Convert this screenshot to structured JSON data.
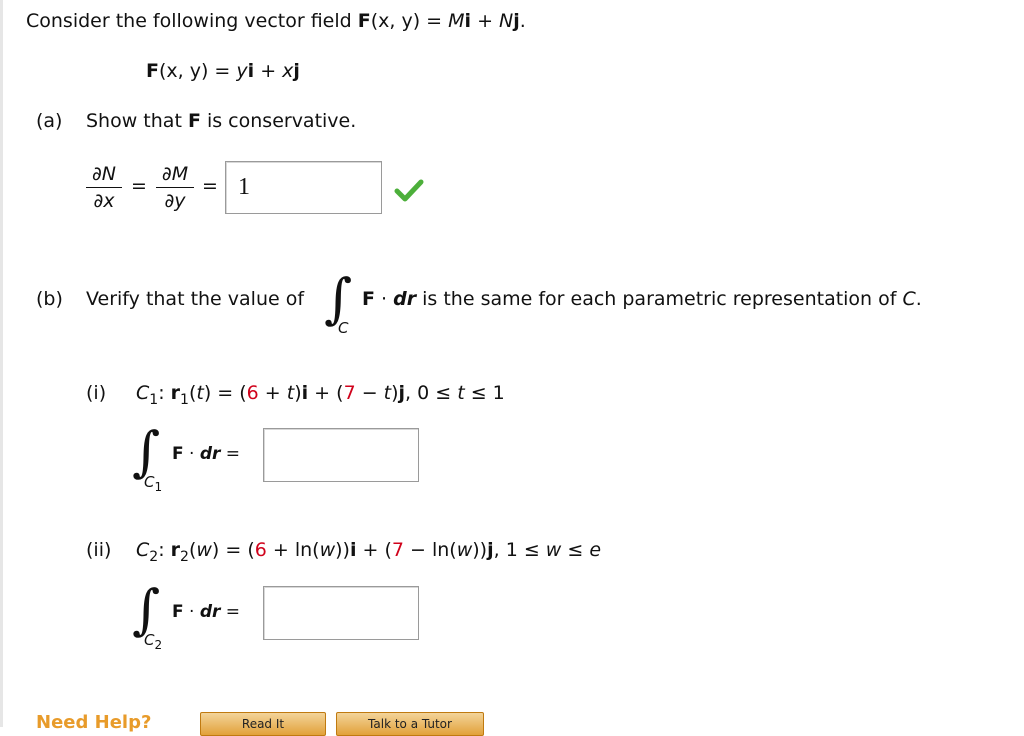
{
  "intro": {
    "text": "Consider the following vector field ",
    "F": "F",
    "args": "(x, y) = ",
    "M": "M",
    "i": "i",
    "plus": " + ",
    "N": "N",
    "j": "j",
    "end": "."
  },
  "field": {
    "F": "F",
    "args": "(x, y) = ",
    "y": "y",
    "i": "i",
    "plus": " + ",
    "x": "x",
    "j": "j"
  },
  "part_a": {
    "label": "(a)",
    "text_before": "Show that ",
    "F": "F",
    "text_after": " is conservative.",
    "num1": "∂N",
    "den1": "∂x",
    "eq1": "=",
    "num2": "∂M",
    "den2": "∂y",
    "eq2": "=",
    "answer": "1"
  },
  "part_b": {
    "label": "(b)",
    "text_before": "Verify that the value of",
    "integral_sub": "C",
    "F": "F",
    "dot": " · ",
    "dr": "dr",
    "text_after": " is the same for each parametric representation of ",
    "C": "C",
    "end": "."
  },
  "part_i": {
    "label": "(i)",
    "C": "C",
    "C_sub": "1",
    "colon": ": ",
    "r": "r",
    "r_sub": "1",
    "t_open": "(",
    "t": "t",
    "t_close": ") = (",
    "six": "6",
    "plus_t": " + ",
    "t2": "t",
    "close_i": ")",
    "i": "i",
    "plus": " + (",
    "seven": "7",
    "minus_t": " − ",
    "t3": "t",
    "close_j": ")",
    "j": "j",
    "range": ", 0 ≤ ",
    "t4": "t",
    "range_end": " ≤ 1",
    "integral_C": "C",
    "integral_sub": "1",
    "F": "F",
    "dot": " · ",
    "dr": "dr",
    "eq": " =",
    "answer": ""
  },
  "part_ii": {
    "label": "(ii)",
    "C": "C",
    "C_sub": "2",
    "colon": ": ",
    "r": "r",
    "r_sub": "2",
    "w_open": "(",
    "w": "w",
    "w_close": ") = (",
    "six": "6",
    "plus_ln": " + ln(",
    "w2": "w",
    "close_i": "))",
    "i": "i",
    "plus": " + (",
    "seven": "7",
    "minus_ln": " − ln(",
    "w3": "w",
    "close_j": "))",
    "j": "j",
    "range": ", 1 ≤ ",
    "w4": "w",
    "range_mid": " ≤ ",
    "e": "e",
    "integral_C": "C",
    "integral_sub": "2",
    "F": "F",
    "dot": " · ",
    "dr": "dr",
    "eq": " =",
    "answer": ""
  },
  "footer": {
    "need_help": "Need Help?",
    "read_it": "Read It",
    "talk_to_tutor": "Talk to a Tutor"
  },
  "colors": {
    "accent_red": "#d0021b",
    "check_green": "#4caf3a",
    "help_orange": "#e89b2a"
  },
  "icons": {
    "correct": "check-icon"
  }
}
